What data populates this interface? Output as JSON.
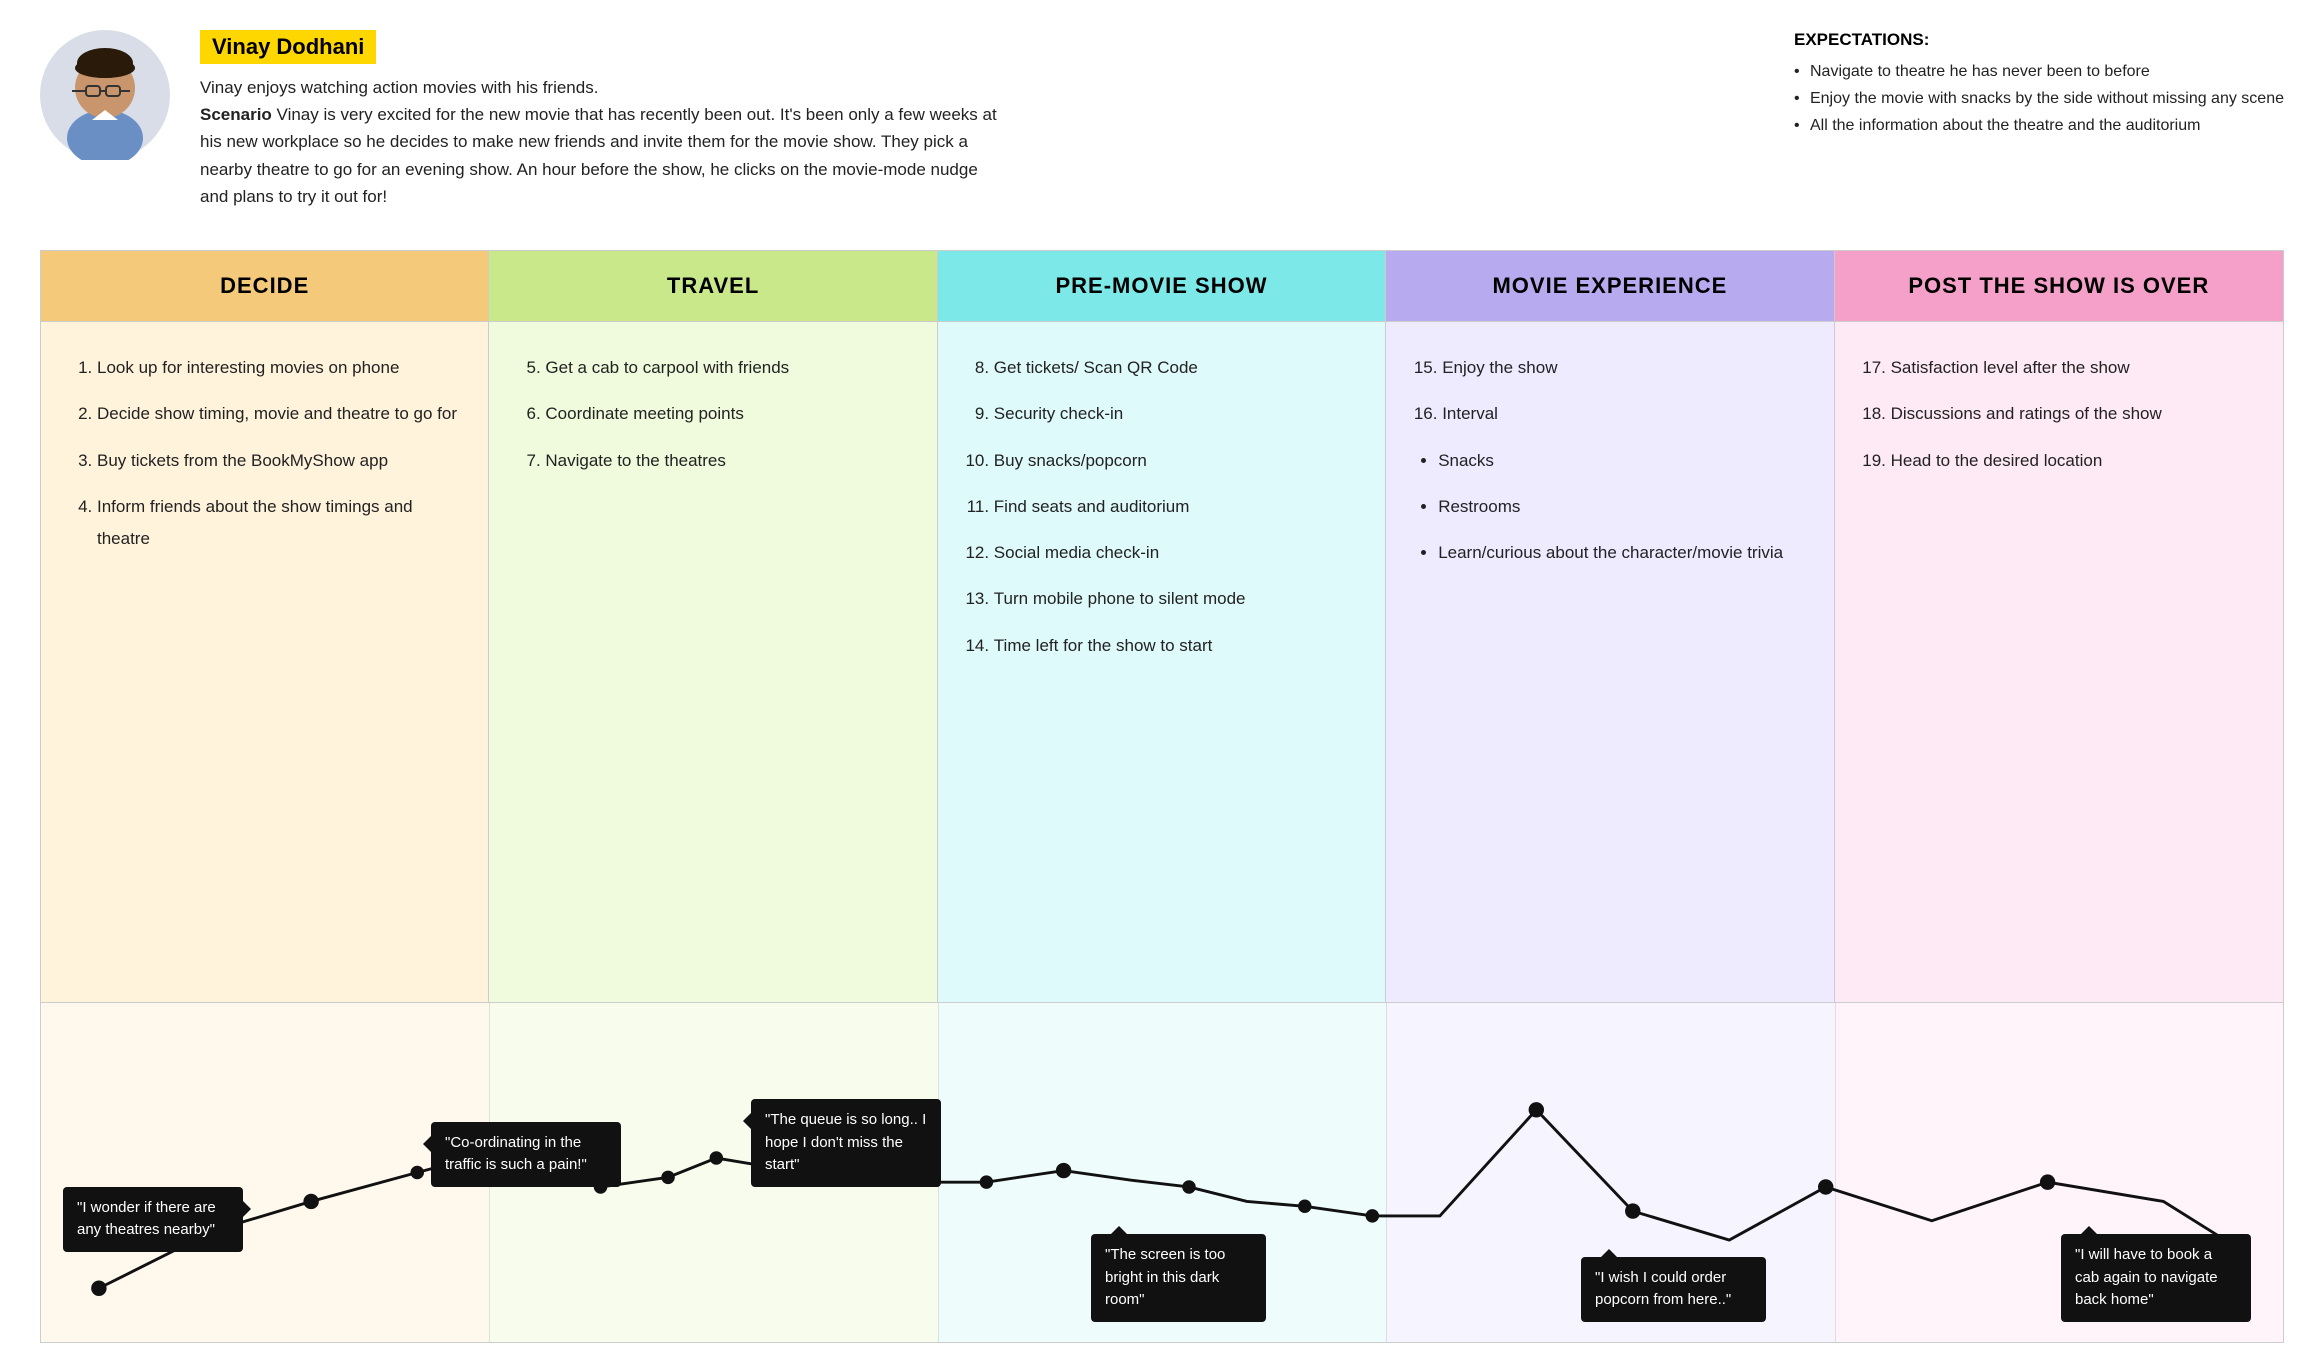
{
  "persona": {
    "name": "Vinay Dodhani",
    "description": "Vinay enjoys watching action movies with his friends.",
    "scenario_label": "Scenario",
    "scenario": "Vinay is very excited for the new movie that has recently been out. It's been only a few weeks at his new workplace so he decides to make new friends and invite them for the movie show. They pick a nearby theatre to go for an evening show. An hour before the show, he clicks on the movie-mode nudge and plans to try it out for!",
    "expectations_title": "EXPECTATIONS:",
    "expectations": [
      "Navigate to theatre he has never been to before",
      "Enjoy the movie with snacks by the side without missing any scene",
      "All the information about the theatre and the auditorium"
    ]
  },
  "phases": [
    {
      "id": "decide",
      "label": "DECIDE",
      "header_class": "ph-decide",
      "col_class": "pc-decide",
      "items_type": "ol",
      "items": [
        {
          "num": 1,
          "text": "Look up for interesting movies on phone"
        },
        {
          "num": 2,
          "text": "Decide show timing, movie and theatre to go for"
        },
        {
          "num": 3,
          "text": "Buy tickets from the BookMyShow app"
        },
        {
          "num": 4,
          "text": "Inform friends about the show timings and theatre"
        }
      ]
    },
    {
      "id": "travel",
      "label": "TRAVEL",
      "header_class": "ph-travel",
      "col_class": "pc-travel",
      "items_type": "ol",
      "items": [
        {
          "num": 5,
          "text": "Get a cab to carpool with friends"
        },
        {
          "num": 6,
          "text": "Coordinate meeting points"
        },
        {
          "num": 7,
          "text": "Navigate to the theatres"
        }
      ]
    },
    {
      "id": "premovie",
      "label": "PRE-MOVIE SHOW",
      "header_class": "ph-premovie",
      "col_class": "pc-premovie",
      "items_type": "ol",
      "items": [
        {
          "num": 8,
          "text": "Get tickets/ Scan QR Code"
        },
        {
          "num": 9,
          "text": "Security check-in"
        },
        {
          "num": 10,
          "text": "Buy snacks/popcorn"
        },
        {
          "num": 11,
          "text": "Find seats and auditorium"
        },
        {
          "num": 12,
          "text": "Social media check-in"
        },
        {
          "num": 13,
          "text": "Turn mobile phone to silent mode"
        },
        {
          "num": 14,
          "text": "Time left for the show to start"
        }
      ]
    },
    {
      "id": "movie",
      "label": "MOVIE EXPERIENCE",
      "header_class": "ph-movie",
      "col_class": "pc-movie",
      "items_type": "mixed",
      "items": [
        {
          "num": 15,
          "text": "Enjoy the show"
        },
        {
          "num": 16,
          "text": "Interval"
        },
        {
          "bullet": true,
          "text": "Snacks"
        },
        {
          "bullet": true,
          "text": "Restrooms"
        },
        {
          "bullet": true,
          "text": "Learn/curious about the character/movie trivia"
        }
      ]
    },
    {
      "id": "post",
      "label": "POST THE SHOW IS OVER",
      "header_class": "ph-post",
      "col_class": "pc-post",
      "items_type": "ol",
      "items": [
        {
          "num": 17,
          "text": "Satisfaction level after the show"
        },
        {
          "num": 18,
          "text": "Discussions and ratings of the show"
        },
        {
          "num": 19,
          "text": "Head to the desired location"
        }
      ]
    }
  ],
  "bubbles": [
    {
      "text": "\"I wonder if there are any theatres nearby\"",
      "class": "bubble-right",
      "style": "left:22px; bottom:130px;"
    },
    {
      "text": "\"Co-ordinating in the traffic is such a pain!\"",
      "class": "bubble-left",
      "style": "left:380px; bottom:105px;"
    },
    {
      "text": "\"The queue is so long.. I hope I don't miss the start\"",
      "class": "bubble-left",
      "style": "left:680px; bottom:160px;"
    },
    {
      "text": "\"The screen is too bright in this dark room\"",
      "class": "bubble-top",
      "style": "left:700px; bottom:30px;"
    },
    {
      "text": "\"I wish I could order popcorn from here..\"",
      "class": "bubble-top",
      "style": "left:970px; bottom:55px;"
    },
    {
      "text": "\"I will have to book a cab again to navigate back home\"",
      "class": "bubble-top",
      "style": "left:1310px; bottom:30px;"
    }
  ]
}
